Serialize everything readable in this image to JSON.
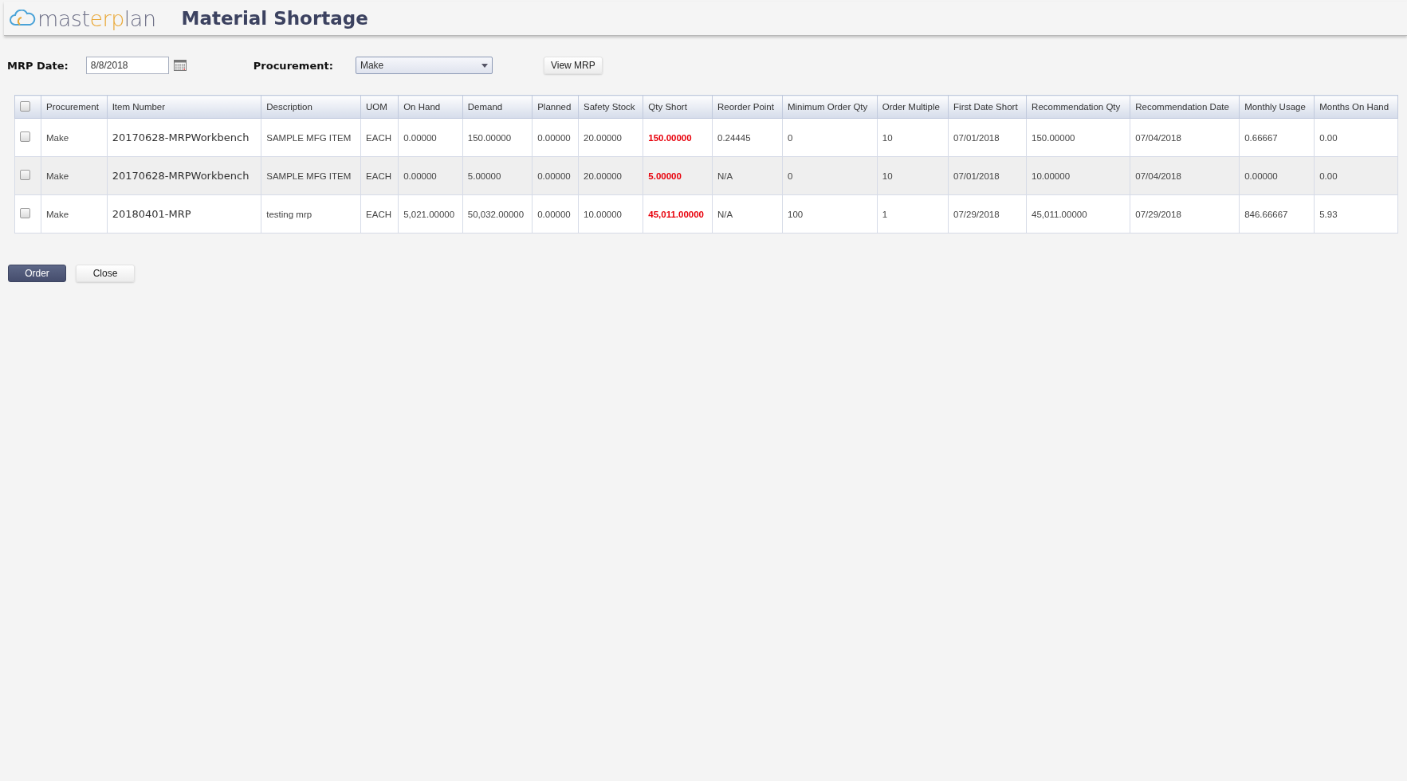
{
  "logo": [
    {
      "text": "mast",
      "kind": "plain"
    },
    {
      "text": "erp",
      "kind": "accent"
    },
    {
      "text": "lan",
      "kind": "plain"
    }
  ],
  "title": "Material Shortage",
  "filters": {
    "date_label": "MRP Date:",
    "date_value": "8/8/2018",
    "procurement_label": "Procurement:",
    "procurement_value": "Make",
    "view_button": "View MRP"
  },
  "table": {
    "select_all_checked": false,
    "columns": [
      {
        "label": "Procurement",
        "kind": "text"
      },
      {
        "label": "Item Number",
        "kind": "item"
      },
      {
        "label": "Description",
        "kind": "text"
      },
      {
        "label": "UOM",
        "kind": "text"
      },
      {
        "label": "On Hand",
        "kind": "text"
      },
      {
        "label": "Demand",
        "kind": "text"
      },
      {
        "label": "Planned",
        "kind": "text"
      },
      {
        "label": "Safety Stock",
        "kind": "text"
      },
      {
        "label": "Qty Short",
        "kind": "alert"
      },
      {
        "label": "Reorder Point",
        "kind": "text"
      },
      {
        "label": "Minimum Order Qty",
        "kind": "text"
      },
      {
        "label": "Order Multiple",
        "kind": "text"
      },
      {
        "label": "First Date Short",
        "kind": "text"
      },
      {
        "label": "Recommendation Qty",
        "kind": "text"
      },
      {
        "label": "Recommendation Date",
        "kind": "text"
      },
      {
        "label": "Monthly Usage",
        "kind": "text"
      },
      {
        "label": "Months On Hand",
        "kind": "text"
      }
    ],
    "rows": [
      {
        "checked": false,
        "cells": [
          "Make",
          "20170628-MRPWorkbench",
          "SAMPLE MFG ITEM",
          "EACH",
          "0.00000",
          "150.00000",
          "0.00000",
          "20.00000",
          "150.00000",
          "0.24445",
          "0",
          "10",
          "07/01/2018",
          "150.00000",
          "07/04/2018",
          "0.66667",
          "0.00"
        ]
      },
      {
        "checked": false,
        "cells": [
          "Make",
          "20170628-MRPWorkbench",
          "SAMPLE MFG ITEM",
          "EACH",
          "0.00000",
          "5.00000",
          "0.00000",
          "20.00000",
          "5.00000",
          "N/A",
          "0",
          "10",
          "07/01/2018",
          "10.00000",
          "07/04/2018",
          "0.00000",
          "0.00"
        ]
      },
      {
        "checked": false,
        "cells": [
          "Make",
          "20180401-MRP",
          "testing mrp",
          "EACH",
          "5,021.00000",
          "50,032.00000",
          "0.00000",
          "10.00000",
          "45,011.00000",
          "N/A",
          "100",
          "1",
          "07/29/2018",
          "45,011.00000",
          "07/29/2018",
          "846.66667",
          "5.93"
        ]
      }
    ]
  },
  "buttons": [
    {
      "label": "Order",
      "kind": "primary"
    },
    {
      "label": "Close",
      "kind": "secondary"
    }
  ]
}
